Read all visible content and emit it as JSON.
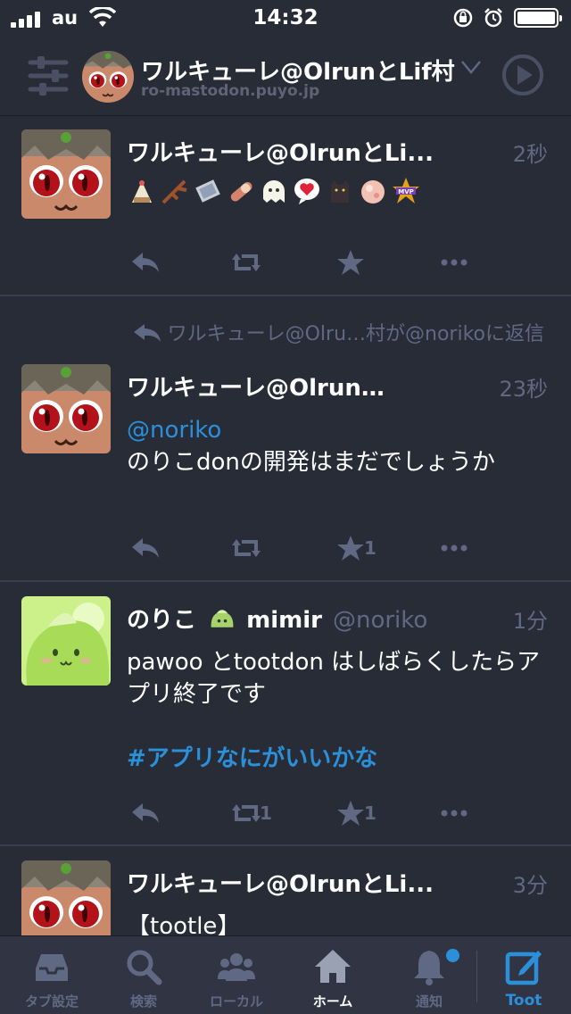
{
  "status_bar": {
    "carrier": "au",
    "time": "14:32"
  },
  "header": {
    "account_name": "ワルキューレ@OlrunとLif村",
    "domain": "ro-mastodon.puyo.jp"
  },
  "timeline": [
    {
      "display_name": "ワルキューレ@OlrunとLi...",
      "time": "2秒",
      "emoji_icons": [
        "cake-icon",
        "branch-icon",
        "scroll-icon",
        "sausage-icon",
        "ghost-icon",
        "heart-bubble-icon",
        "cat-icon",
        "peach-icon",
        "mvp-icon"
      ],
      "favourites": "",
      "reblogs": ""
    },
    {
      "reblog_note": "ワルキューレ@Olru…村が@norikoに返信",
      "display_name": "ワルキューレ@Olrun…",
      "time": "23秒",
      "mention": "@noriko",
      "content": "のりこdonの開発はまだでしょうか",
      "favourites": "1",
      "reblogs": ""
    },
    {
      "display_name": "のりこ",
      "display_name_suffix": "mimir",
      "acct": "@noriko",
      "time": "1分",
      "content": "pawoo とtootdon はしばらくしたらアプリ終了です",
      "hashtag": "#アプリなにがいいかな",
      "reblogs": "1",
      "favourites": "1"
    },
    {
      "display_name": "ワルキューレ@OlrunとLi...",
      "time": "3分",
      "content": "【tootle】"
    }
  ],
  "tabbar": {
    "tabs": [
      {
        "label": "タブ設定",
        "icon": "inbox-icon"
      },
      {
        "label": "検索",
        "icon": "search-icon"
      },
      {
        "label": "ローカル",
        "icon": "users-icon"
      },
      {
        "label": "ホーム",
        "icon": "home-icon"
      },
      {
        "label": "通知",
        "icon": "bell-icon"
      },
      {
        "label": "Toot",
        "icon": "compose-icon"
      }
    ],
    "active": "ホーム",
    "colors": {
      "accent": "#2b90d9",
      "inactive": "#606984",
      "background": "#313543"
    }
  }
}
